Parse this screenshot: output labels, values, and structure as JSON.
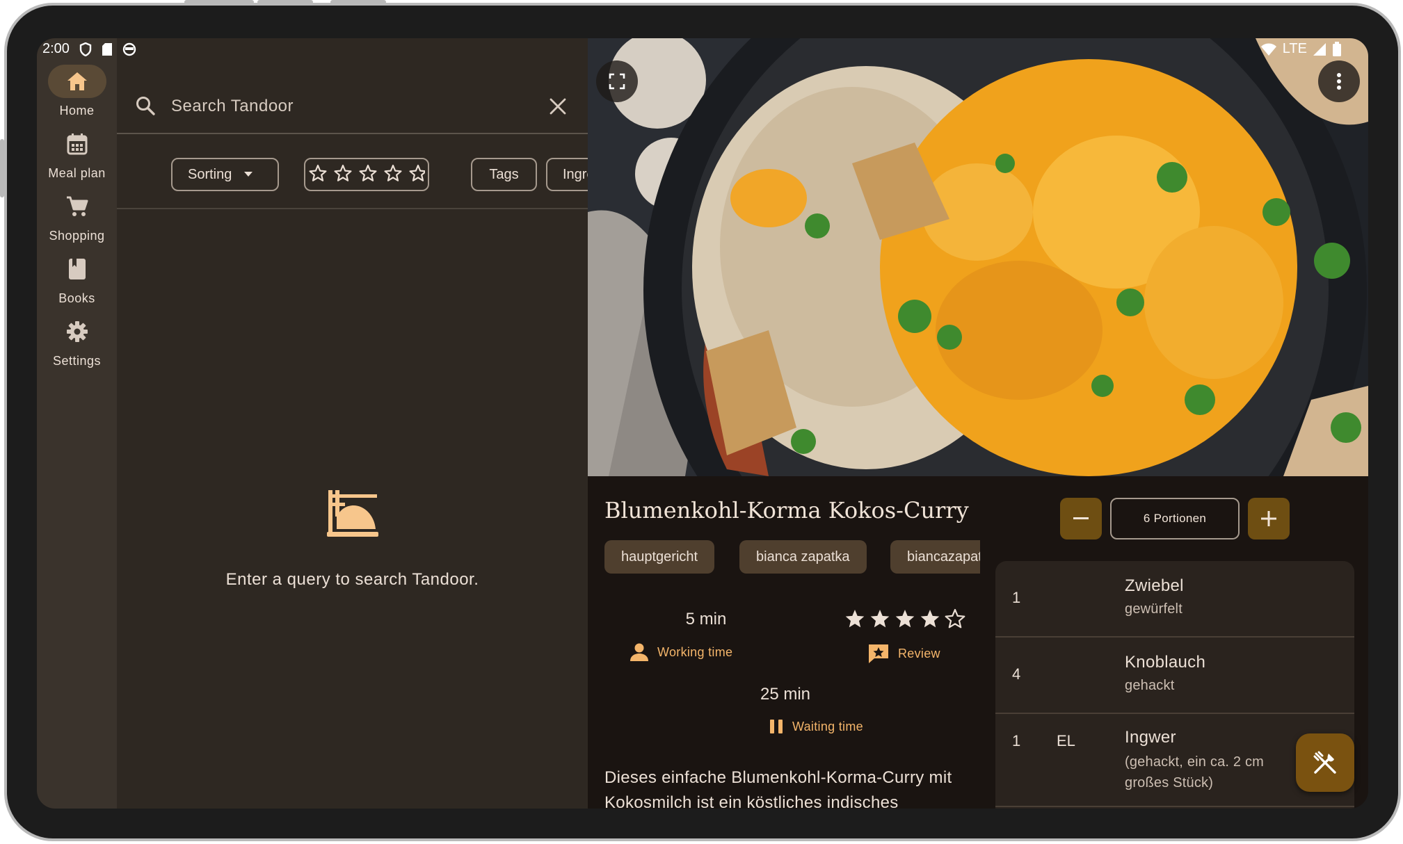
{
  "status_bar": {
    "time": "2:00",
    "network": "LTE"
  },
  "nav": {
    "items": [
      {
        "label": "Home",
        "icon": "home-icon",
        "active": true
      },
      {
        "label": "Meal plan",
        "icon": "calendar-icon",
        "active": false
      },
      {
        "label": "Shopping",
        "icon": "cart-icon",
        "active": false
      },
      {
        "label": "Books",
        "icon": "book-icon",
        "active": false
      },
      {
        "label": "Settings",
        "icon": "gear-icon",
        "active": false
      }
    ]
  },
  "search": {
    "placeholder": "Search Tandoor",
    "chips": {
      "sorting": "Sorting",
      "tags": "Tags",
      "ingredients": "Ingredients"
    },
    "empty_message": "Enter a query to search Tandoor."
  },
  "recipe": {
    "title": "Blumenkohl-Korma Kokos-Curry",
    "tags": [
      "hauptgericht",
      "bianca zapatka",
      "biancazapatka"
    ],
    "working_time": "5 min",
    "working_time_label": "Working time",
    "rating": 4,
    "rating_max": 5,
    "review_label": "Review",
    "waiting_time": "25 min",
    "waiting_time_label": "Waiting time",
    "description": "Dieses einfache Blumenkohl-Korma-Curry mit Kokosmilch ist ein köstliches indisches",
    "portions": "6 Portionen",
    "ingredients": [
      {
        "amount": "1",
        "unit": "",
        "name": "Zwiebel",
        "note": "gewürfelt"
      },
      {
        "amount": "4",
        "unit": "",
        "name": "Knoblauch",
        "note": "gehackt"
      },
      {
        "amount": "1",
        "unit": "EL",
        "name": "Ingwer",
        "note": "(gehackt, ein ca. 2 cm großes Stück)"
      }
    ]
  },
  "colors": {
    "accent": "#f4b56a",
    "button_fill": "#6e4e12",
    "background": "#201a17"
  }
}
